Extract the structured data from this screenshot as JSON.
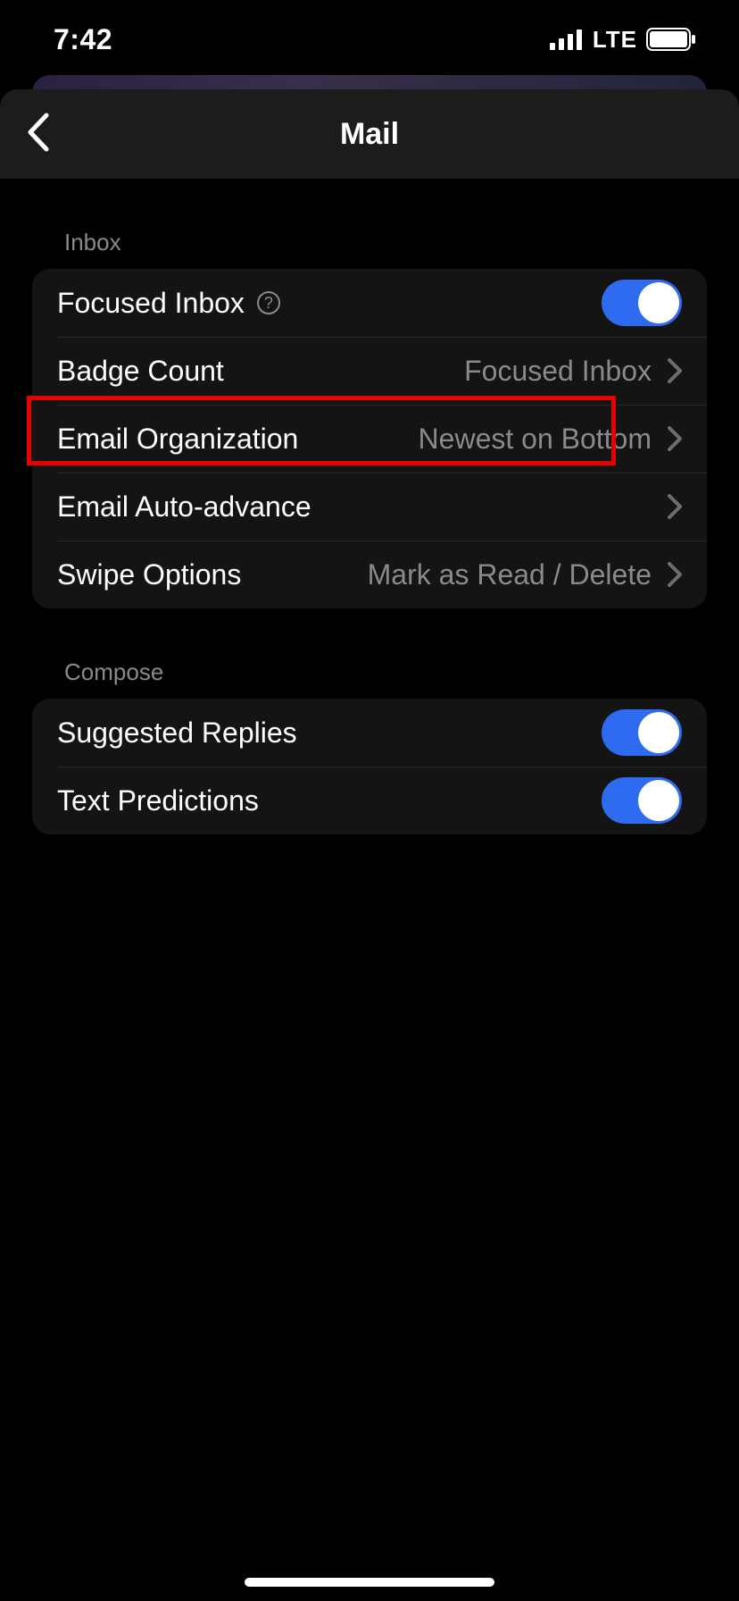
{
  "statusbar": {
    "time": "7:42",
    "network": "LTE"
  },
  "header": {
    "title": "Mail"
  },
  "sections": {
    "inbox": {
      "title": "Inbox",
      "rows": {
        "focused_inbox": {
          "label": "Focused Inbox",
          "toggle_on": true
        },
        "badge_count": {
          "label": "Badge Count",
          "value": "Focused Inbox"
        },
        "email_org": {
          "label": "Email Organization",
          "value": "Newest on Bottom"
        },
        "auto_advance": {
          "label": "Email Auto-advance",
          "value": ""
        },
        "swipe": {
          "label": "Swipe Options",
          "value": "Mark as Read / Delete"
        }
      }
    },
    "compose": {
      "title": "Compose",
      "rows": {
        "suggested_replies": {
          "label": "Suggested Replies",
          "toggle_on": true
        },
        "text_predictions": {
          "label": "Text Predictions",
          "toggle_on": true
        }
      }
    }
  },
  "highlight": {
    "target": "email-organization-row"
  }
}
